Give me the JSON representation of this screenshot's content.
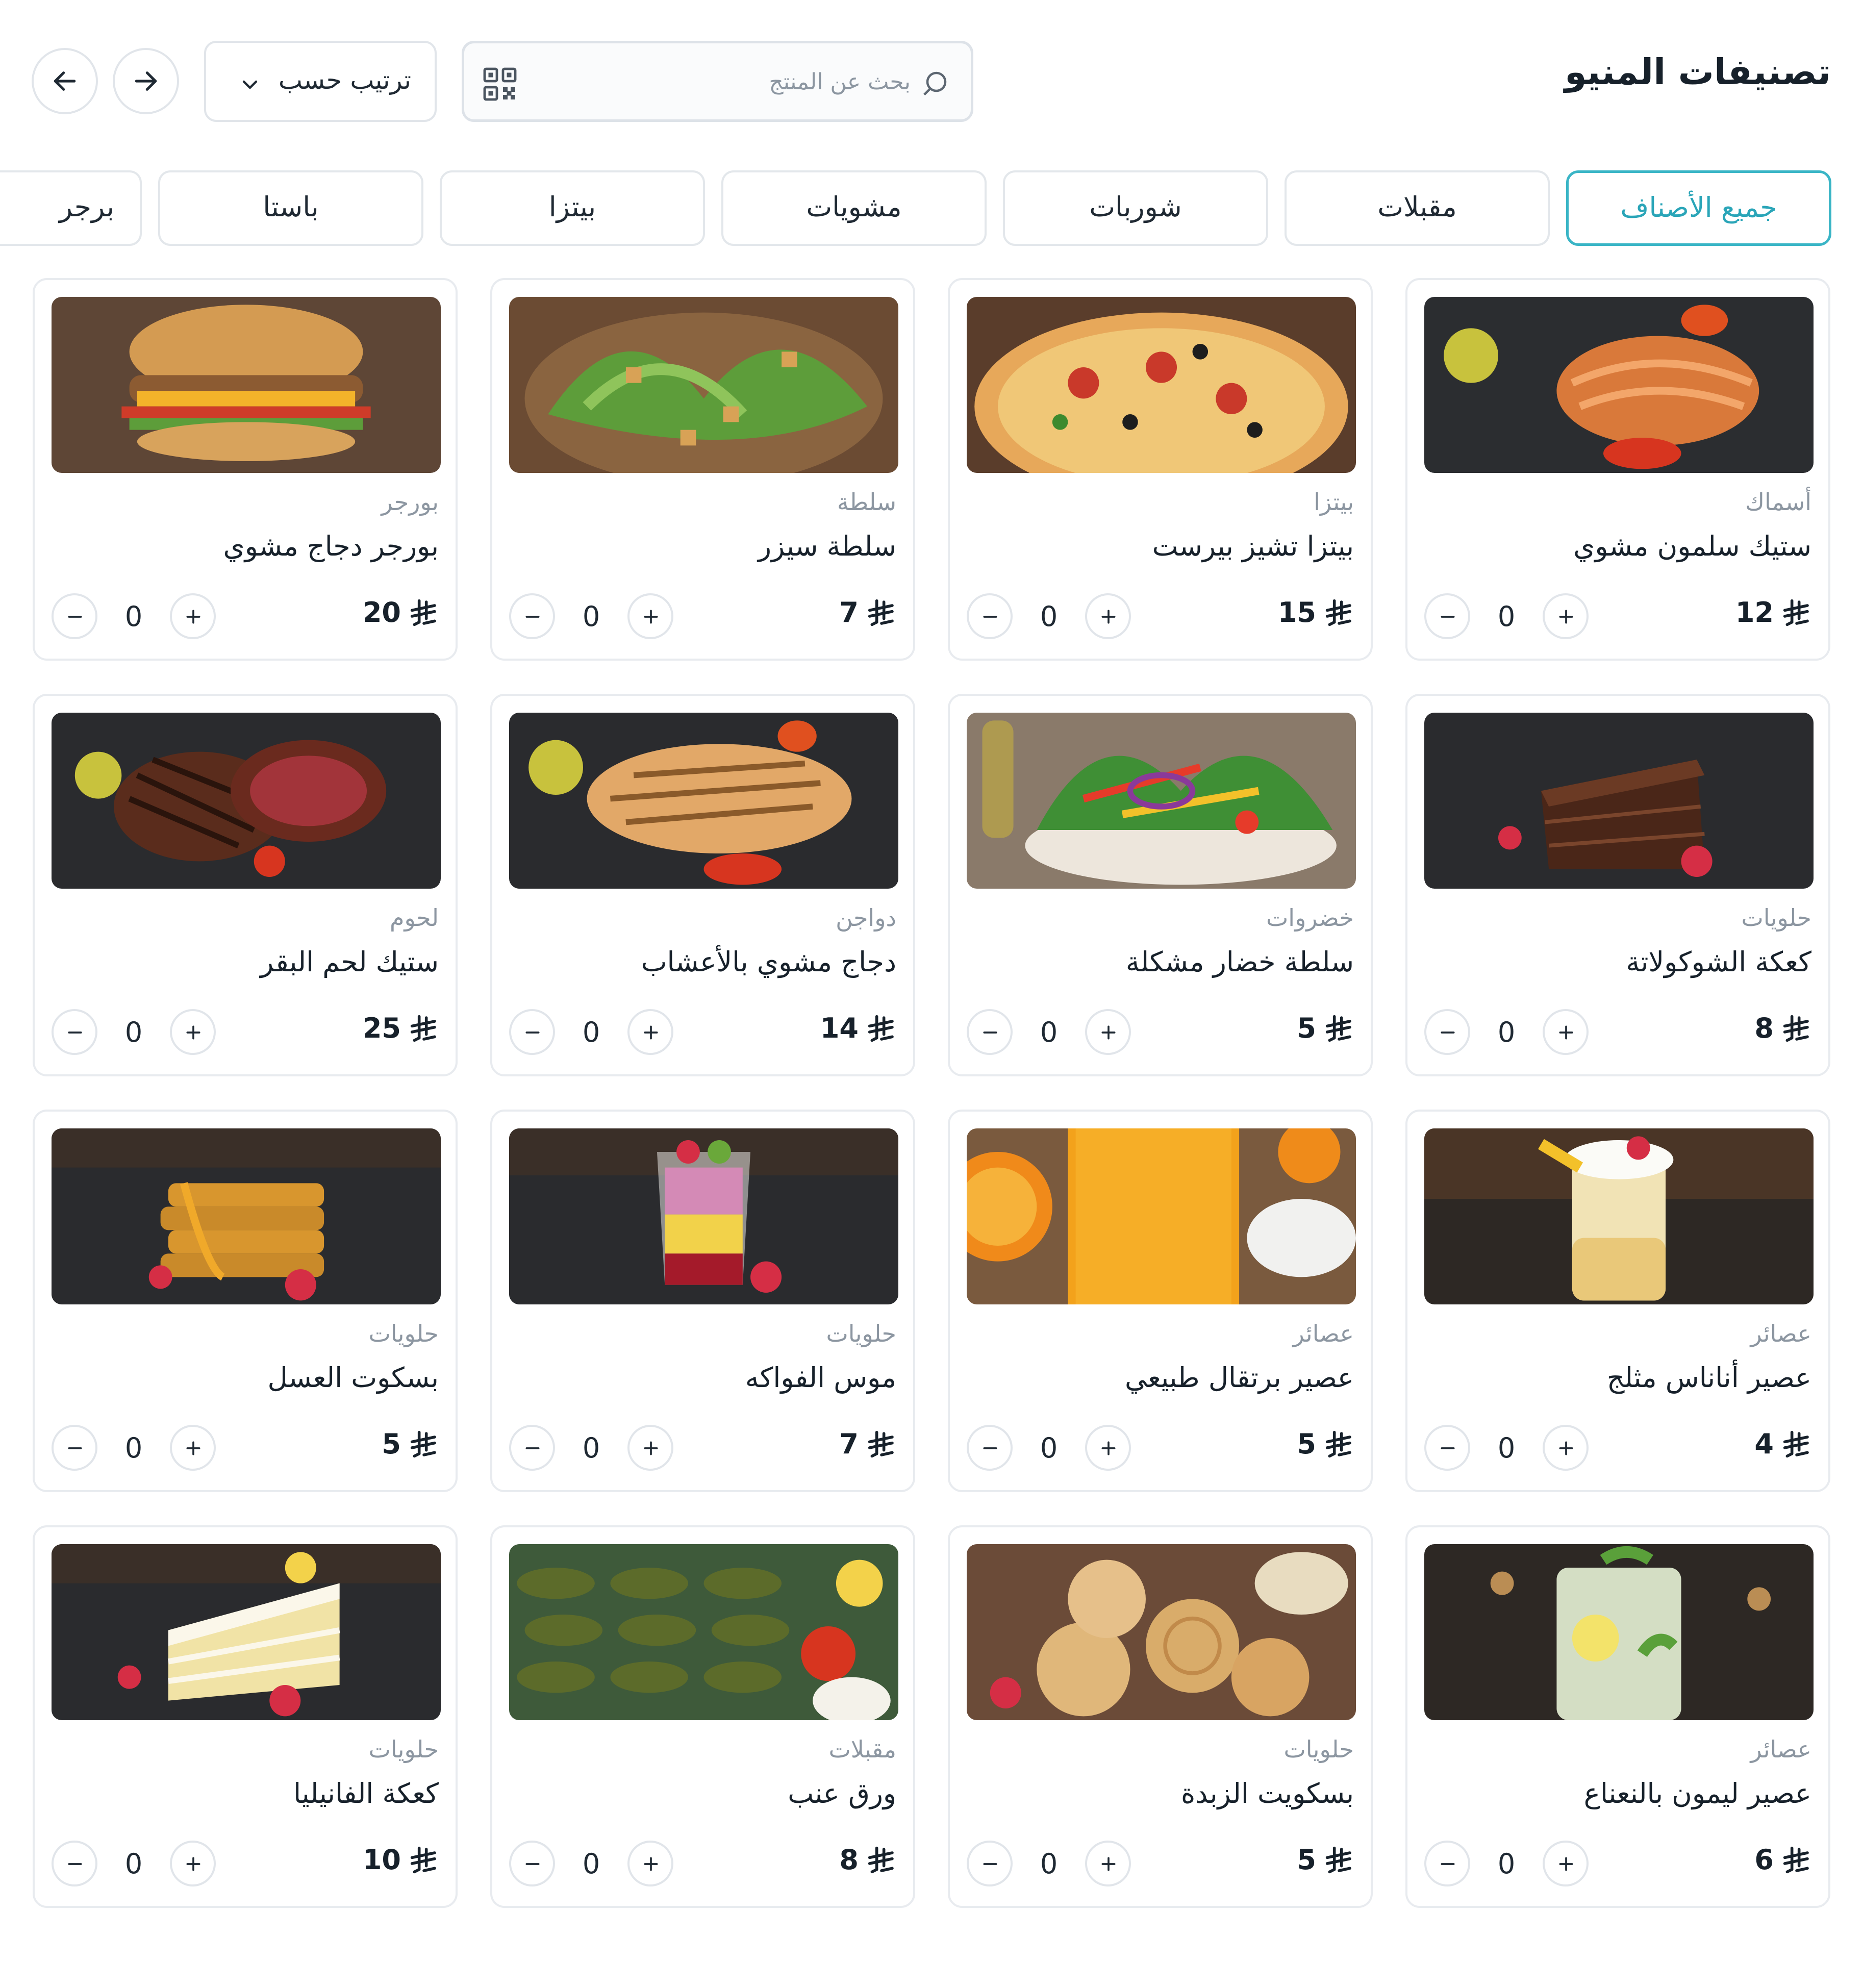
{
  "header": {
    "title": "تصنيفات المنيو",
    "search_placeholder": "بحث عن المنتج",
    "sort_label": "ترتيب حسب"
  },
  "tabs": [
    {
      "label": "جميع الأصناف",
      "active": true
    },
    {
      "label": "مقبلات",
      "active": false
    },
    {
      "label": "شوربات",
      "active": false
    },
    {
      "label": "مشويات",
      "active": false
    },
    {
      "label": "بيتزا",
      "active": false
    },
    {
      "label": "باستا",
      "active": false
    },
    {
      "label": "برجر",
      "active": false
    }
  ],
  "currency_icon": "riyal-icon",
  "products": [
    {
      "category": "أسماك",
      "name": "ستيك سلمون مشوي",
      "price": "12",
      "qty": "0",
      "image": "salmon-steak"
    },
    {
      "category": "بيتزا",
      "name": "بيتزا تشيز بيرست",
      "price": "15",
      "qty": "0",
      "image": "pizza"
    },
    {
      "category": "سلطة",
      "name": "سلطة سيزر",
      "price": "7",
      "qty": "0",
      "image": "caesar-salad"
    },
    {
      "category": "بورجر",
      "name": "بورجر دجاج مشوي",
      "price": "20",
      "qty": "0",
      "image": "chicken-burger"
    },
    {
      "category": "حلويات",
      "name": "كعكة الشوكولاتة",
      "price": "8",
      "qty": "0",
      "image": "chocolate-cake"
    },
    {
      "category": "خضروات",
      "name": "سلطة خضار مشكلة",
      "price": "5",
      "qty": "0",
      "image": "mixed-salad"
    },
    {
      "category": "دواجن",
      "name": "دجاج مشوي بالأعشاب",
      "price": "14",
      "qty": "0",
      "image": "grilled-chicken"
    },
    {
      "category": "لحوم",
      "name": "ستيك لحم البقر",
      "price": "25",
      "qty": "0",
      "image": "beef-steak"
    },
    {
      "category": "عصائر",
      "name": "عصير أناناس مثلج",
      "price": "4",
      "qty": "0",
      "image": "pineapple-juice"
    },
    {
      "category": "عصائر",
      "name": "عصير برتقال طبيعي",
      "price": "5",
      "qty": "0",
      "image": "orange-juice"
    },
    {
      "category": "حلويات",
      "name": "موس الفواكه",
      "price": "7",
      "qty": "0",
      "image": "fruit-mousse"
    },
    {
      "category": "حلويات",
      "name": "بسكوت العسل",
      "price": "5",
      "qty": "0",
      "image": "honey-biscuits"
    },
    {
      "category": "عصائر",
      "name": "عصير ليمون بالنعناع",
      "price": "6",
      "qty": "0",
      "image": "lemon-mint-juice"
    },
    {
      "category": "حلويات",
      "name": "بسكويت الزبدة",
      "price": "5",
      "qty": "0",
      "image": "butter-cookies"
    },
    {
      "category": "مقبلات",
      "name": "ورق عنب",
      "price": "8",
      "qty": "0",
      "image": "grape-leaves"
    },
    {
      "category": "حلويات",
      "name": "كعكة الفانيليا",
      "price": "10",
      "qty": "0",
      "image": "vanilla-cake"
    }
  ],
  "colors": {
    "accent": "#3ab5c6",
    "border": "#e3e7eb",
    "muted_text": "#8c96a1",
    "text": "#17212b"
  }
}
